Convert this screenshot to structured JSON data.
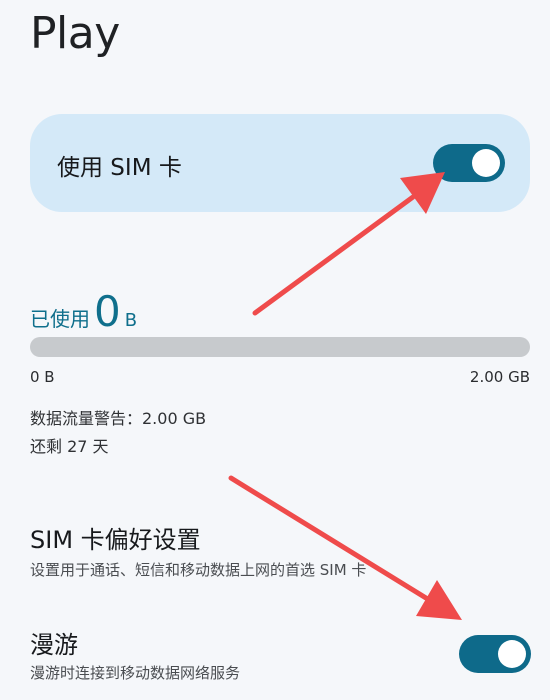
{
  "header": {
    "title": "Play"
  },
  "sim": {
    "label": "使用 SIM 卡",
    "enabled": true
  },
  "usage": {
    "used_label": "已使用",
    "used_value": "0",
    "used_unit": "B",
    "fraction_used": 0,
    "range_min": "0 B",
    "range_max": "2.00 GB",
    "warning": "数据流量警告：2.00 GB",
    "days_left": "还剩 27 天"
  },
  "preferences": {
    "title": "SIM 卡偏好设置",
    "subtitle": "设置用于通话、短信和移动数据上网的首选 SIM 卡"
  },
  "roaming": {
    "title": "漫游",
    "subtitle": "漫游时连接到移动数据网络服务",
    "enabled": true
  },
  "colors": {
    "accent": "#0e6a8a",
    "card": "#d4e9f8",
    "annotation_arrow": "#ef4b4b",
    "background": "#f5f7fa"
  }
}
